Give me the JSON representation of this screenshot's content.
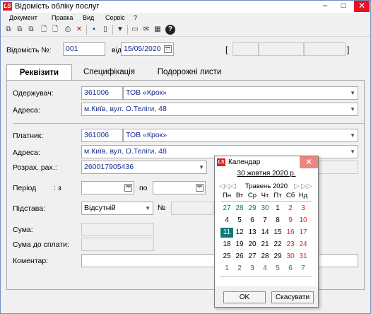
{
  "window": {
    "logo": "LS",
    "title": "Відомість обліку послуг",
    "min": "–",
    "max": "□",
    "close": "✕"
  },
  "menu": [
    "Документ",
    "Правка",
    "Вид",
    "Сервіс",
    "?"
  ],
  "toolbar_icons": [
    "copy-icon",
    "copy-icon",
    "copy-icon",
    "new-doc-icon",
    "new-doc-icon",
    "print-icon",
    "delete-icon",
    "save-icon",
    "book-icon",
    "filter-icon",
    "doc-icon",
    "mail-icon",
    "calc-icon",
    "help-icon"
  ],
  "header": {
    "number_label": "Відомість №:",
    "number_value": "001",
    "date_label": "від",
    "date_value": "15/05/2020",
    "bracket_left": "[",
    "bracket_right": "]"
  },
  "tabs": [
    "Реквізити",
    "Специфікація",
    "Подорожні листи"
  ],
  "recipient": {
    "label": "Одержувач:",
    "code": "361006",
    "name": "ТОВ «Крок»",
    "address_label": "Адреса:",
    "address": "м.Київ, вул. О.Теліги, 48"
  },
  "payer": {
    "label": "Платник:",
    "code": "361006",
    "name": "ТОВ «Крок»",
    "address_label": "Адреса:",
    "address": "м.Київ, вул. О.Теліги, 48",
    "account_label": "Розрах. рах.:",
    "account": "260017905436"
  },
  "period": {
    "label": "Період",
    "from_label": ": з",
    "to_label": "по"
  },
  "basis": {
    "label": "Підстава:",
    "value": "Відсутній",
    "number_label": "№"
  },
  "sum_label": "Сума:",
  "sum_to_pay_label": "Сума до сплати:",
  "comment_label": "Коментар:",
  "calendar": {
    "logo": "LS",
    "title": "Календар",
    "close": "✕",
    "today": "30 жовтня 2020 р.",
    "month": "Травень 2020",
    "nav_prev_year": "◁◁",
    "nav_prev": "◁",
    "nav_next": "▷",
    "nav_next_year": "▷▷",
    "weekdays": [
      "Пн",
      "Вт",
      "Ср",
      "Чт",
      "Пт",
      "Сб",
      "Нд"
    ],
    "weeks": [
      [
        {
          "d": "27",
          "c": "#0f7a73"
        },
        {
          "d": "28",
          "c": "#0f7a73"
        },
        {
          "d": "29",
          "c": "#0f7a73"
        },
        {
          "d": "30",
          "c": "#0f7a73"
        },
        {
          "d": "1",
          "c": "#000"
        },
        {
          "d": "2",
          "c": "#d42a2a"
        },
        {
          "d": "3",
          "c": "#d42a2a"
        }
      ],
      [
        {
          "d": "4",
          "c": "#000"
        },
        {
          "d": "5",
          "c": "#000"
        },
        {
          "d": "6",
          "c": "#000"
        },
        {
          "d": "7",
          "c": "#000"
        },
        {
          "d": "8",
          "c": "#000"
        },
        {
          "d": "9",
          "c": "#d42a2a"
        },
        {
          "d": "10",
          "c": "#d42a2a"
        }
      ],
      [
        {
          "d": "11",
          "c": "#fff",
          "sel": true
        },
        {
          "d": "12",
          "c": "#000"
        },
        {
          "d": "13",
          "c": "#000"
        },
        {
          "d": "14",
          "c": "#000"
        },
        {
          "d": "15",
          "c": "#000"
        },
        {
          "d": "16",
          "c": "#d42a2a"
        },
        {
          "d": "17",
          "c": "#d42a2a"
        }
      ],
      [
        {
          "d": "18",
          "c": "#000"
        },
        {
          "d": "19",
          "c": "#000"
        },
        {
          "d": "20",
          "c": "#000"
        },
        {
          "d": "21",
          "c": "#000"
        },
        {
          "d": "22",
          "c": "#000"
        },
        {
          "d": "23",
          "c": "#d42a2a"
        },
        {
          "d": "24",
          "c": "#d42a2a"
        }
      ],
      [
        {
          "d": "25",
          "c": "#000"
        },
        {
          "d": "26",
          "c": "#000"
        },
        {
          "d": "27",
          "c": "#000"
        },
        {
          "d": "28",
          "c": "#000"
        },
        {
          "d": "29",
          "c": "#000"
        },
        {
          "d": "30",
          "c": "#d42a2a"
        },
        {
          "d": "31",
          "c": "#d42a2a"
        }
      ],
      [
        {
          "d": "1",
          "c": "#0f7a73"
        },
        {
          "d": "2",
          "c": "#0f7a73"
        },
        {
          "d": "3",
          "c": "#0f7a73"
        },
        {
          "d": "4",
          "c": "#0f7a73"
        },
        {
          "d": "5",
          "c": "#0f7a73"
        },
        {
          "d": "6",
          "c": "#0f7a73"
        },
        {
          "d": "7",
          "c": "#0f7a73"
        }
      ]
    ],
    "ok": "OK",
    "cancel": "Скасувати"
  }
}
